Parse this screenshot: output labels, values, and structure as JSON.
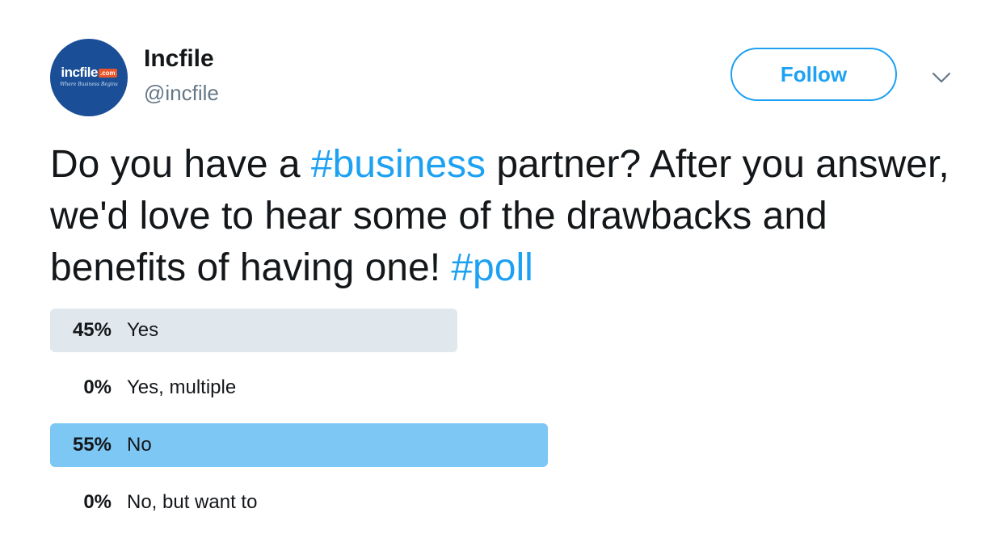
{
  "account": {
    "avatar_logo_text": "incfile",
    "avatar_logo_badge": ".com",
    "avatar_logo_tagline": "Where Business Begins",
    "name": "Incfile",
    "handle": "@incfile"
  },
  "follow_button": {
    "label": "Follow",
    "color": "#1da1f2"
  },
  "caret_icon": "chevron-down-icon",
  "tweet": {
    "text_1": "Do you have a ",
    "hashtag_1": "#business",
    "text_2": " partner? After you answer, we'd love to hear some of the drawbacks and benefits of having one! ",
    "hashtag_2": "#poll",
    "hashtag_color": "#1da1f2"
  },
  "poll": {
    "options": [
      {
        "percent_label": "45%",
        "label": "Yes",
        "fraction": 0.45,
        "leading": false
      },
      {
        "percent_label": "0%",
        "label": "Yes, multiple",
        "fraction": 0,
        "leading": false
      },
      {
        "percent_label": "55%",
        "label": "No",
        "fraction": 0.55,
        "leading": true
      },
      {
        "percent_label": "0%",
        "label": "No, but want to",
        "fraction": 0,
        "leading": false
      }
    ],
    "bar_color": "#e1e8ed",
    "leading_bar_color": "#7dc7f4"
  }
}
